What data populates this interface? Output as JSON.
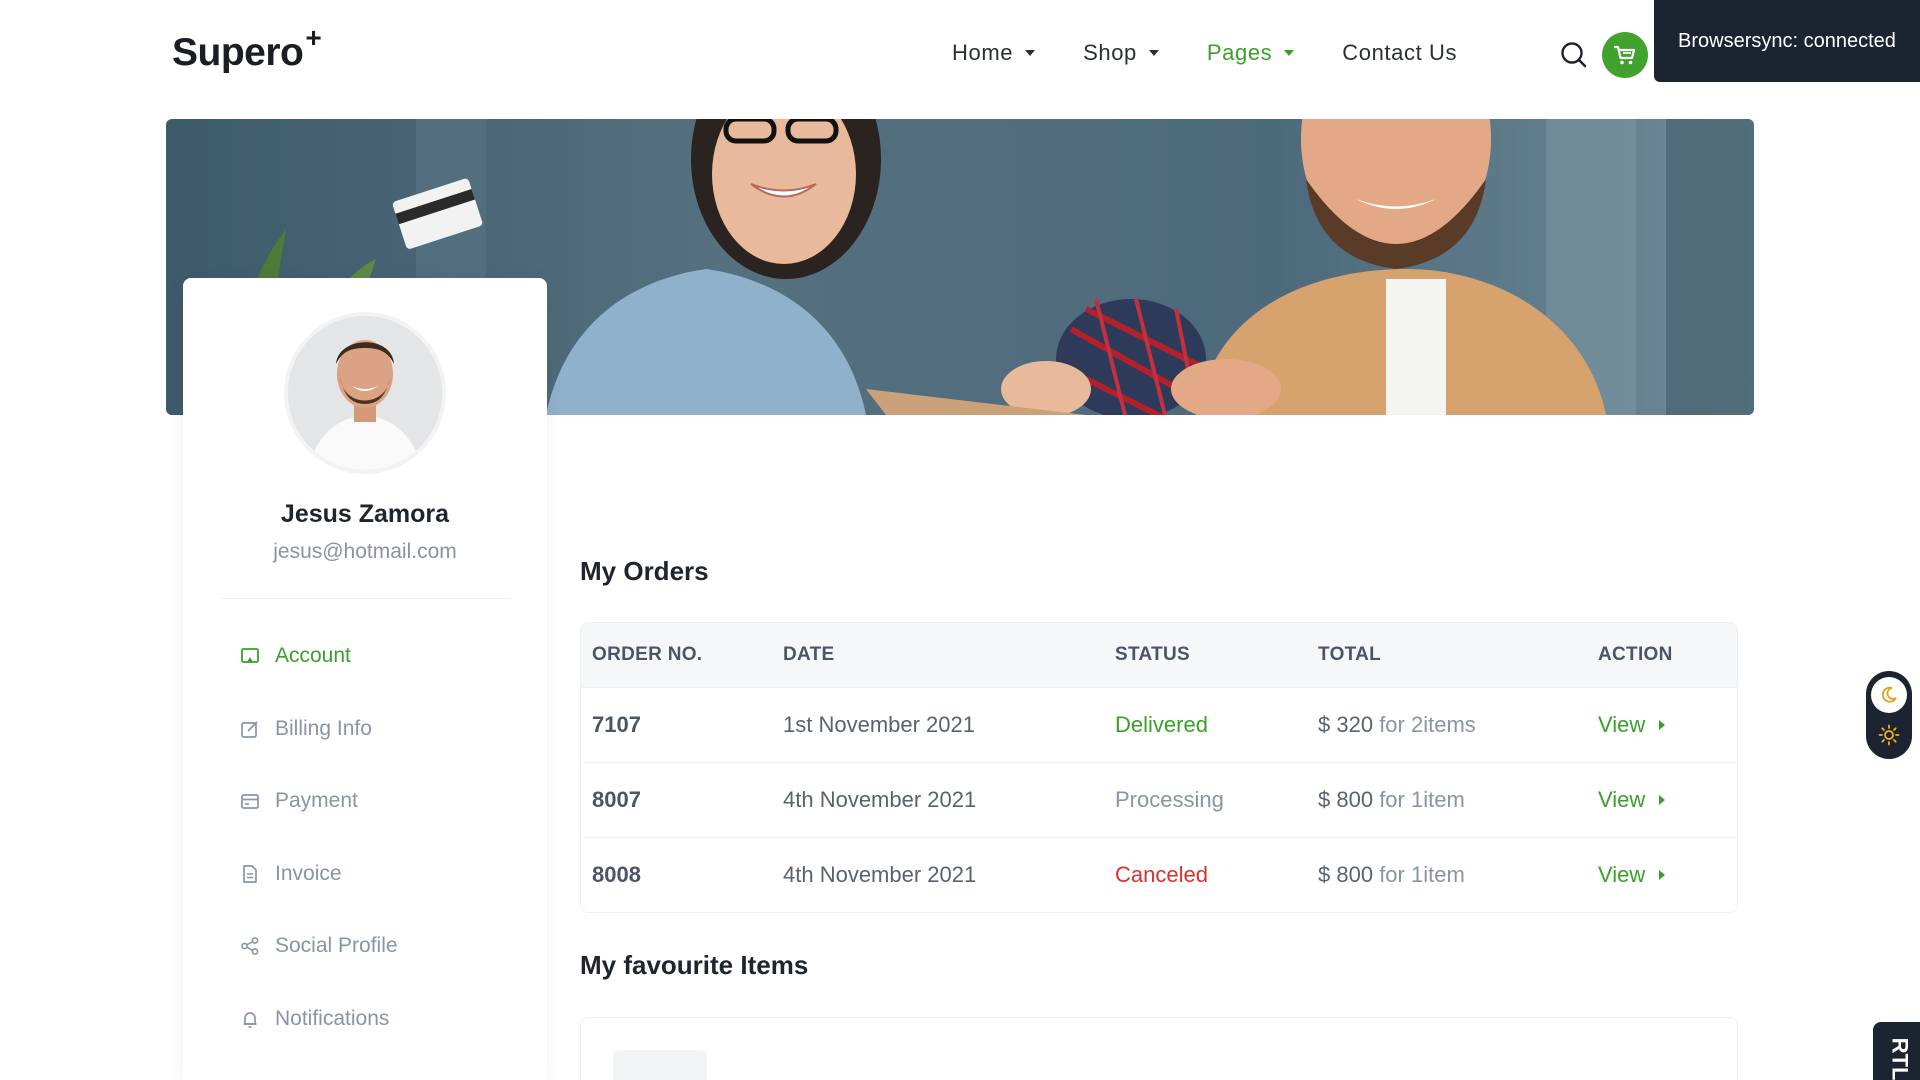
{
  "brand": {
    "name": "Supero",
    "mark": "+"
  },
  "nav": {
    "items": [
      {
        "label": "Home",
        "dropdown": true,
        "active": false
      },
      {
        "label": "Shop",
        "dropdown": true,
        "active": false
      },
      {
        "label": "Pages",
        "dropdown": true,
        "active": true
      },
      {
        "label": "Contact Us",
        "dropdown": false,
        "active": false
      }
    ],
    "icons": [
      "search-icon",
      "cart-icon"
    ]
  },
  "browsersync": {
    "text": "Browsersync: connected"
  },
  "profile": {
    "name": "Jesus Zamora",
    "email": "jesus@hotmail.com",
    "menu": [
      {
        "label": "Account",
        "icon": "account-icon",
        "active": true
      },
      {
        "label": "Billing Info",
        "icon": "edit-icon",
        "active": false
      },
      {
        "label": "Payment",
        "icon": "card-icon",
        "active": false
      },
      {
        "label": "Invoice",
        "icon": "document-icon",
        "active": false
      },
      {
        "label": "Social Profile",
        "icon": "share-icon",
        "active": false
      },
      {
        "label": "Notifications",
        "icon": "bell-icon",
        "active": false
      }
    ]
  },
  "orders": {
    "title": "My Orders",
    "columns": [
      "ORDER NO.",
      "DATE",
      "STATUS",
      "TOTAL",
      "ACTION"
    ],
    "rows": [
      {
        "order_no": "7107",
        "date": "1st November 2021",
        "status": "Delivered",
        "total": "$ 320",
        "total_sub": "for 2items",
        "action": "View"
      },
      {
        "order_no": "8007",
        "date": "4th November 2021",
        "status": "Processing",
        "total": "$ 800",
        "total_sub": "for 1item",
        "action": "View"
      },
      {
        "order_no": "8008",
        "date": "4th November 2021",
        "status": "Canceled",
        "total": "$ 800",
        "total_sub": "for 1item",
        "action": "View"
      }
    ]
  },
  "favourites": {
    "title": "My favourite Items"
  },
  "widgets": {
    "rtl_label": "RTL"
  },
  "colors": {
    "accent": "#41a32e",
    "dark": "#1c2331",
    "danger": "#d93030",
    "muted": "#8a94a6"
  }
}
